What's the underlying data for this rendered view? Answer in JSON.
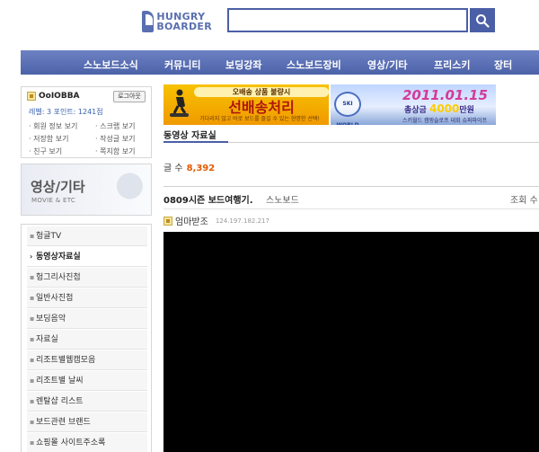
{
  "header": {
    "logo_line1": "HUNGRY",
    "logo_line2": "BOARDER",
    "search_value": "",
    "search_icon": "search-icon"
  },
  "nav": {
    "items": [
      "스노보드소식",
      "커뮤니티",
      "보딩강좌",
      "스노보드장비",
      "영상/기타",
      "프리스키",
      "장터"
    ]
  },
  "login": {
    "username": "OoIOBBA",
    "logout_label": "로그아웃",
    "level_text": "레벨: 3  포인트: 1241점",
    "links": [
      "회원 정보 보기",
      "스크랩 보기",
      "저장함 보기",
      "작성글 보기",
      "친구 보기",
      "쪽지함 보기"
    ]
  },
  "category": {
    "title": "영상/기타",
    "subtitle": "MOVIE & ETC"
  },
  "side_menu": {
    "items": [
      "헝글TV",
      "동영상자료실",
      "헝그리사진첩",
      "일반사진첩",
      "보딩음악",
      "자료실",
      "리조트별웹캠모음",
      "리조트별 날씨",
      "렌탈샵 리스트",
      "보드관련 브랜드",
      "쇼핑몰 사이트주소록"
    ],
    "active_index": 1
  },
  "banner1": {
    "top": "오배송 상품 불량시",
    "main": "선배송처리",
    "sub": "기다리지 않고 바로 보드를 즐길 수 있는 현명한 선택!"
  },
  "banner2": {
    "logo": "SKI WORLD",
    "date": "2011.01.15",
    "prize_prefix": "총상금",
    "prize_amount": "4000",
    "prize_suffix": "만원",
    "tag": "스키월드 캠핑슬로프 대회 슈퍼파이프"
  },
  "board": {
    "title": "동영상 자료실",
    "count_label": "글 수",
    "count_value": "8,392"
  },
  "post": {
    "title": "0809시즌 보드여행기.",
    "category": "스노보드",
    "views_label": "조회 수",
    "author": "엄마받조",
    "ip": "124.197.182.217"
  },
  "colors": {
    "accent": "#4a5fa5",
    "nav_top": "#6d82c4",
    "count": "#e25a00"
  }
}
